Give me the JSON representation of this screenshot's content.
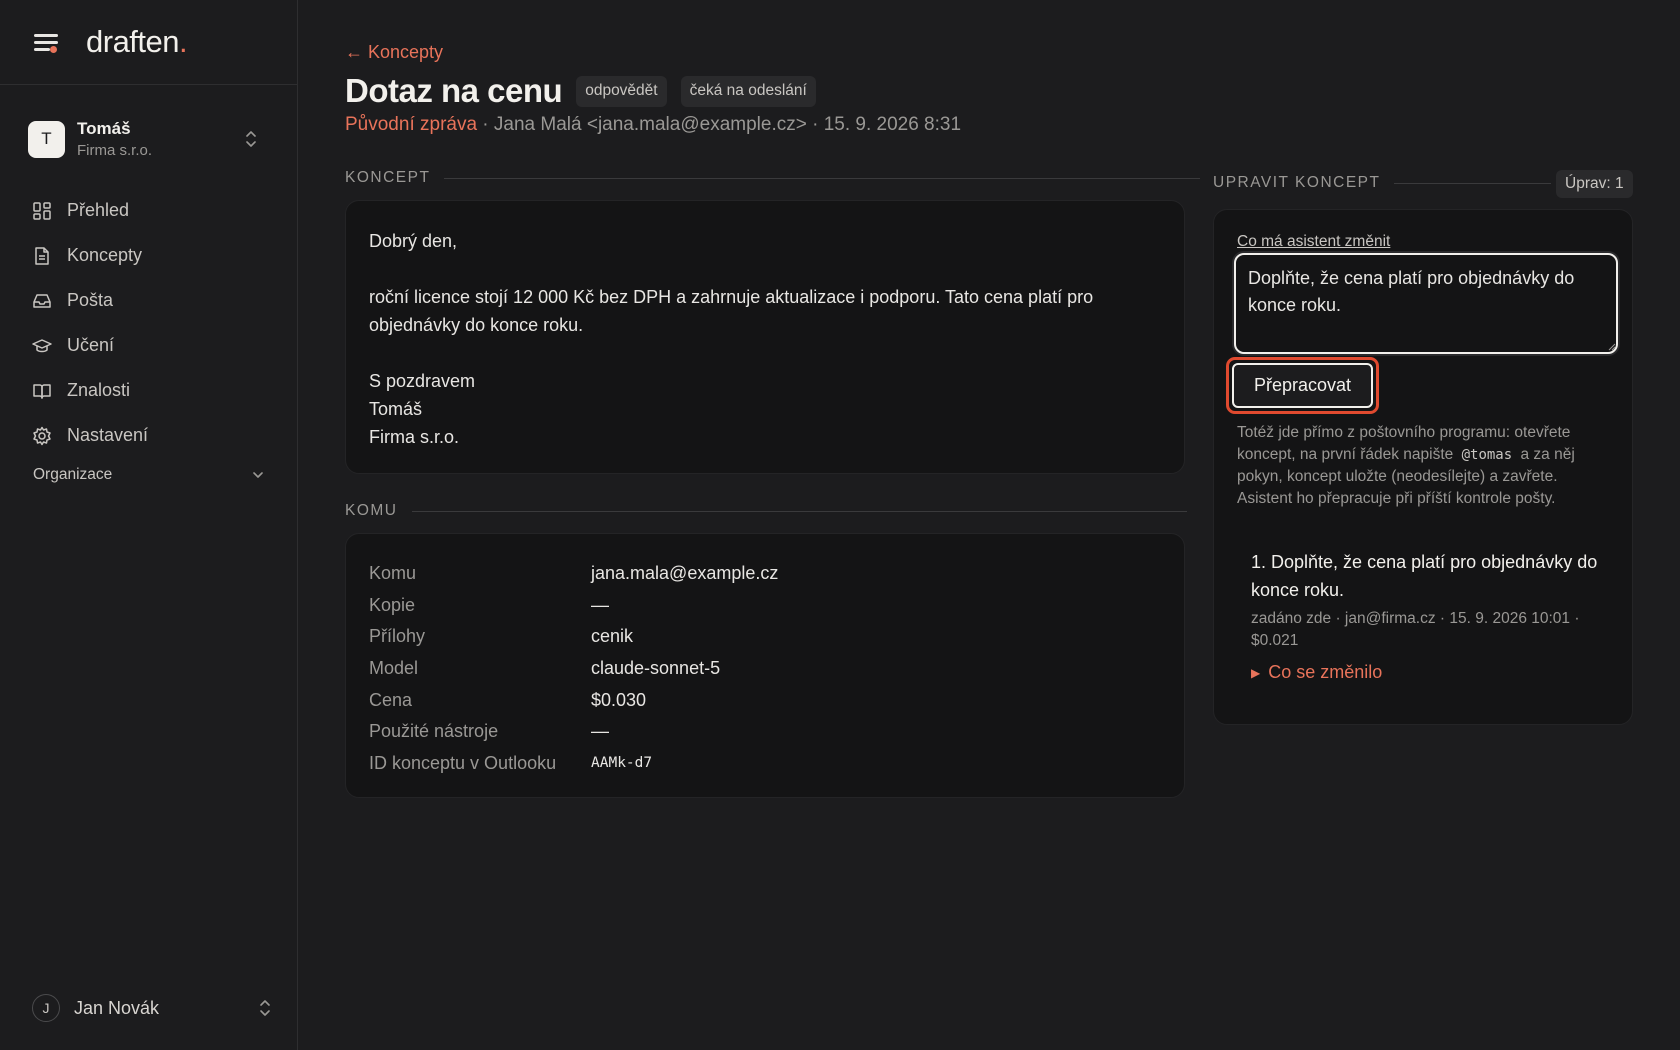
{
  "brand": {
    "name": "draften",
    "dot": "."
  },
  "account": {
    "initial": "T",
    "name": "Tomáš",
    "org": "Firma s.r.o."
  },
  "nav": [
    {
      "label": "Přehled",
      "icon": "dashboard-icon"
    },
    {
      "label": "Koncepty",
      "icon": "document-icon"
    },
    {
      "label": "Pošta",
      "icon": "inbox-icon"
    },
    {
      "label": "Učení",
      "icon": "graduation-cap-icon"
    },
    {
      "label": "Znalosti",
      "icon": "book-icon"
    },
    {
      "label": "Nastavení",
      "icon": "gear-icon"
    }
  ],
  "org_section": "Organizace",
  "user": {
    "initial": "J",
    "name": "Jan Novák"
  },
  "header": {
    "back": "← Koncepty",
    "title": "Dotaz na cenu",
    "chips": [
      "odpovědět",
      "čeká na odeslání"
    ],
    "original_link": "Původní zpráva",
    "meta": " · Jana Malá <jana.mala@example.cz> · 15. 9. 2026 8:31"
  },
  "draft": {
    "label": "KONCEPT",
    "greeting": "Dobrý den,",
    "body_line1": "roční licence stojí 12 000 Kč bez DPH a zahrnuje aktualizace i podporu. Tato cena platí pro",
    "body_line2": "objednávky do konce roku.",
    "closing": "S pozdravem",
    "sig_name": "Tomáš",
    "sig_org": "Firma s.r.o."
  },
  "details": {
    "label": "KOMU",
    "rows": [
      {
        "key": "Komu",
        "value": "jana.mala@example.cz"
      },
      {
        "key": "Kopie",
        "value": "—"
      },
      {
        "key": "Přílohy",
        "value": "cenik"
      },
      {
        "key": "Model",
        "value": "claude-sonnet-5"
      },
      {
        "key": "Cena",
        "value": "$0.030"
      },
      {
        "key": "Použité nástroje",
        "value": "—"
      },
      {
        "key": "ID konceptu v Outlooku",
        "value": "AAMk-d7"
      }
    ]
  },
  "edit": {
    "label": "UPRAVIT KONCEPT",
    "count": "Úprav: 1",
    "field_label": "Co má asistent změnit",
    "field_value": "Doplňte, že cena platí pro objednávky do konce roku.",
    "button": "Přepracovat",
    "help_before": "Totéž jde přímo z poštovního programu: otevřete koncept, na první řádek napište",
    "help_code": "@tomas",
    "help_after": "a za něj pokyn, koncept uložte (neodesílejte) a zavřete. Asistent ho přepracuje při příští kontrole pošty.",
    "history": {
      "title": "1. Doplňte, že cena platí pro objednávky do konce roku.",
      "meta": "zadáno zde · jan@firma.cz · 15. 9. 2026 10:01 · $0.021",
      "toggle": "Co se změnilo"
    }
  },
  "colors": {
    "accent": "#e8735a",
    "highlight": "#e04a2f",
    "background": "#1c1c1e",
    "card": "#141415"
  }
}
